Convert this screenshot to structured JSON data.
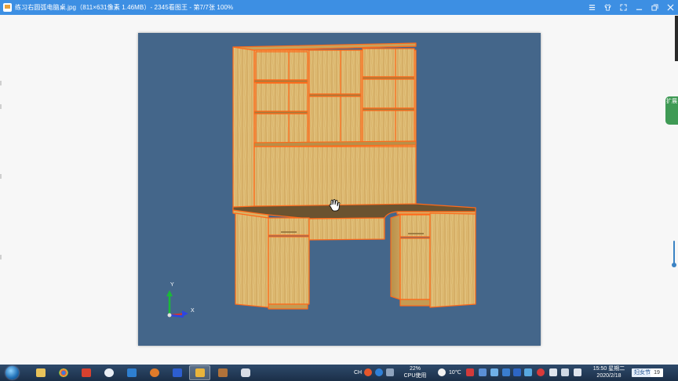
{
  "window": {
    "title": "练习右圆弧电脑桌.jpg（811×631像素 1.46MB）- 2345看图王 - 第7/7张 100%"
  },
  "viewer": {
    "side_tab_label": "扩展",
    "axis_y_label": "Y",
    "axis_x_label": "X"
  },
  "taskbar": {
    "apps": [
      "explorer",
      "chrome",
      "wps",
      "app4",
      "app5",
      "app6",
      "app7",
      "2345viewer",
      "files",
      "recorder"
    ],
    "tray": {
      "lang": "CH",
      "cpu_percent": "22%",
      "cpu_label": "CPU使用",
      "temperature": "10℃",
      "time": "15:50 星期二",
      "date": "2020/2/18",
      "festival": "妇女节",
      "calendar_day": "19"
    }
  },
  "colors": {
    "titlebar": "#3d8fe3",
    "canvas_bg": "#44668a",
    "selection_outline": "#ff6a1a",
    "wood": "#d9b56a"
  }
}
